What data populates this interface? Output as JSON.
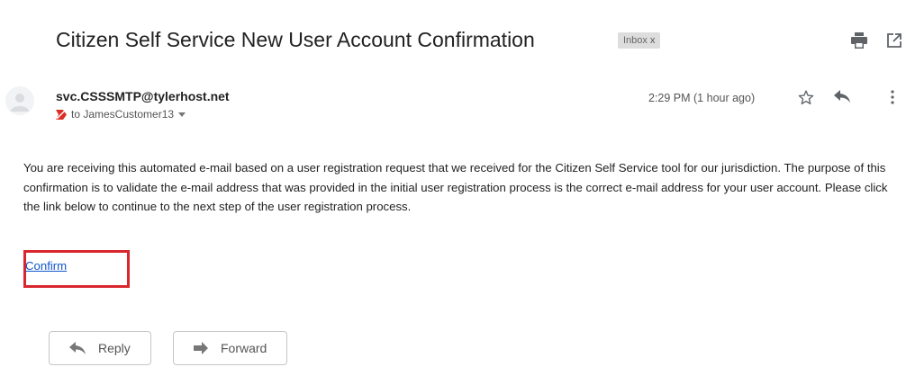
{
  "email": {
    "subject": "Citizen Self Service New User Account Confirmation",
    "label_chip": "Inbox",
    "chip_close": "x",
    "sender": "svc.CSSSMTP@tylerhost.net",
    "recipient": "to JamesCustomer13",
    "timestamp": "2:29 PM (1 hour ago)",
    "body": "You are receiving this automated e-mail based on a user registration request that we received for the Citizen Self Service tool for our jurisdiction. The purpose of this confirmation is to validate the e-mail address that was provided in the initial user registration process is the correct e-mail address for your user account. Please click the link below to continue to the next step of the user registration process.",
    "confirm_link": "Confirm"
  },
  "actions": {
    "reply_label": "Reply",
    "forward_label": "Forward"
  },
  "icons": {
    "print": "print-icon",
    "open_new_window": "open-in-new-window-icon",
    "star": "star-icon",
    "reply": "reply-icon",
    "more": "more-vert-icon",
    "importance": "importance-marker-icon",
    "dropdown": "chevron-down-icon",
    "forward": "forward-icon",
    "avatar": "avatar-icon"
  },
  "colors": {
    "link": "#1155cc",
    "highlight_box": "#d9262e",
    "importance_marker": "#d93025"
  }
}
